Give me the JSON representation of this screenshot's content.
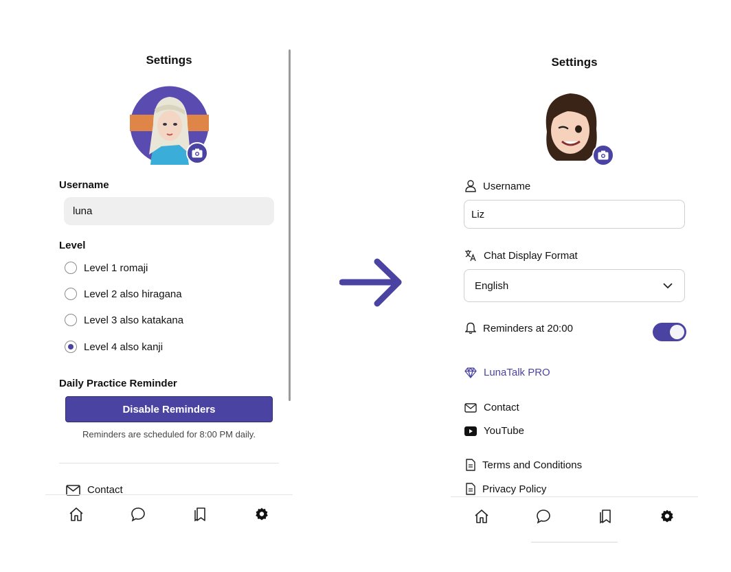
{
  "left": {
    "title": "Settings",
    "username_label": "Username",
    "username_value": "luna",
    "level_label": "Level",
    "levels": [
      {
        "label": "Level 1 romaji",
        "checked": false
      },
      {
        "label": "Level 2 also hiragana",
        "checked": false
      },
      {
        "label": "Level 3 also katakana",
        "checked": false
      },
      {
        "label": "Level 4 also kanji",
        "checked": true
      }
    ],
    "reminder_label": "Daily Practice Reminder",
    "reminder_button": "Disable Reminders",
    "reminder_note": "Reminders are scheduled for 8:00 PM daily.",
    "contact": "Contact"
  },
  "right": {
    "title": "Settings",
    "username_label": "Username",
    "username_value": "Liz",
    "format_label": "Chat Display Format",
    "format_value": "English",
    "reminders_label": "Reminders at 20:00",
    "reminders_on": true,
    "pro_label": "LunaTalk PRO",
    "contact": "Contact",
    "youtube": "YouTube",
    "terms": "Terms and Conditions",
    "privacy": "Privacy Policy"
  },
  "nav": [
    "home-icon",
    "chat-icon",
    "bookmarks-icon",
    "settings-icon"
  ],
  "colors": {
    "accent": "#4b43a2",
    "field_bg": "#efefef",
    "border": "#d0d0d0"
  }
}
